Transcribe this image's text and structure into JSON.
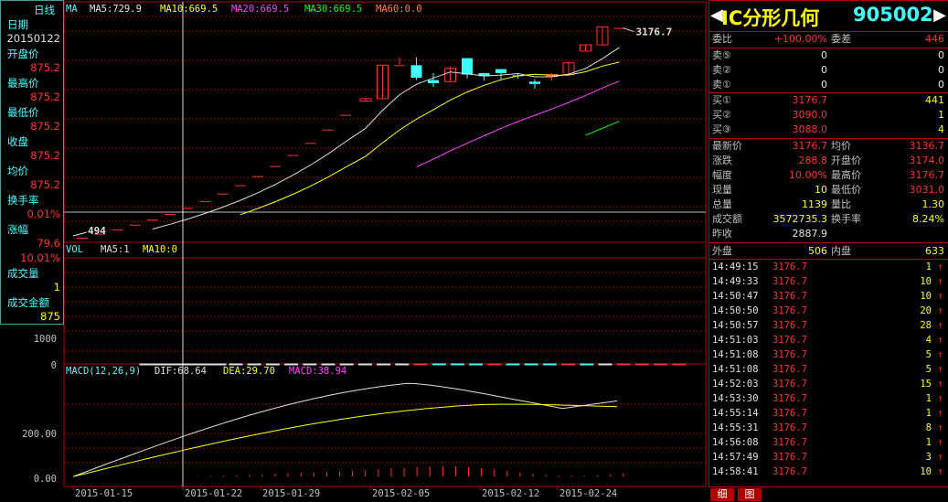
{
  "left_panel": {
    "title": "日线",
    "items": [
      {
        "label": "日期",
        "value": "20150122",
        "value_color": "#e0e0e0"
      },
      {
        "label": "开盘价",
        "value": "875.2"
      },
      {
        "label": "最高价",
        "value": "875.2"
      },
      {
        "label": "最低价",
        "value": "875.2"
      },
      {
        "label": "收盘",
        "value": "875.2"
      },
      {
        "label": "均价",
        "value": "875.2"
      },
      {
        "label": "换手率",
        "value": "0.01%"
      },
      {
        "label": "涨幅",
        "value": "79.6"
      },
      {
        "label": "",
        "value": "10.01%"
      },
      {
        "label": "成交量",
        "value": "1",
        "value_color": "#ffff00"
      },
      {
        "label": "成交金额",
        "value": "875",
        "value_color": "#ffff00"
      }
    ]
  },
  "ma_legend": [
    {
      "text": "MA",
      "color": "#40ffff"
    },
    {
      "text": "MA5:729.9",
      "color": "#e0e0e0"
    },
    {
      "text": "MA10:669.5",
      "color": "#ffff00"
    },
    {
      "text": "MA20:669.5",
      "color": "#ff40ff"
    },
    {
      "text": "MA30:669.5",
      "color": "#00ff00"
    },
    {
      "text": "MA60:0.0",
      "color": "#ff8040"
    }
  ],
  "vol_legend": [
    {
      "text": "VOL",
      "color": "#40ffff"
    },
    {
      "text": "MA5:1",
      "color": "#e0e0e0"
    },
    {
      "text": "MA10:0",
      "color": "#ffff00"
    }
  ],
  "macd_legend": [
    {
      "text": "MACD(12,26,9)",
      "color": "#40ffff"
    },
    {
      "text": "DIF:68.64",
      "color": "#e0e0e0"
    },
    {
      "text": "DEA:29.70",
      "color": "#ffff00"
    },
    {
      "text": "MACD:38.94",
      "color": "#ff40ff"
    }
  ],
  "price_labels": {
    "last_high": "3176.7",
    "low_marker": "494"
  },
  "vol_axis": [
    "1000",
    "0"
  ],
  "macd_axis": [
    "200.00",
    "0.00"
  ],
  "date_axis": [
    "2015-01-15",
    "2015-01-22",
    "2015-01-29",
    "2015-02-05",
    "2015-02-12",
    "2015-02-24"
  ],
  "colors": {
    "up": "#ff3030",
    "down": "#40ffff",
    "grid": "#b00000"
  },
  "chart_data": {
    "type": "candlestick",
    "note_dates": [
      "2015-01-15",
      "2015-01-22",
      "2015-01-29",
      "2015-02-05",
      "2015-02-12",
      "2015-02-24"
    ],
    "candles": [
      {
        "o": 494,
        "h": 494,
        "l": 494,
        "c": 494
      },
      {
        "o": 545,
        "h": 545,
        "l": 545,
        "c": 545
      },
      {
        "o": 600,
        "h": 600,
        "l": 600,
        "c": 600
      },
      {
        "o": 660,
        "h": 660,
        "l": 660,
        "c": 660
      },
      {
        "o": 726,
        "h": 726,
        "l": 726,
        "c": 726
      },
      {
        "o": 798,
        "h": 798,
        "l": 798,
        "c": 798
      },
      {
        "o": 875,
        "h": 875,
        "l": 875,
        "c": 875
      },
      {
        "o": 963,
        "h": 963,
        "l": 963,
        "c": 963
      },
      {
        "o": 1059,
        "h": 1059,
        "l": 1059,
        "c": 1059
      },
      {
        "o": 1165,
        "h": 1165,
        "l": 1165,
        "c": 1165
      },
      {
        "o": 1282,
        "h": 1282,
        "l": 1282,
        "c": 1282
      },
      {
        "o": 1410,
        "h": 1410,
        "l": 1410,
        "c": 1410
      },
      {
        "o": 1551,
        "h": 1551,
        "l": 1551,
        "c": 1551
      },
      {
        "o": 1706,
        "h": 1706,
        "l": 1706,
        "c": 1706
      },
      {
        "o": 1877,
        "h": 1877,
        "l": 1877,
        "c": 1877
      },
      {
        "o": 2065,
        "h": 2065,
        "l": 2065,
        "c": 2065
      },
      {
        "o": 2240,
        "h": 2272,
        "l": 2240,
        "c": 2272
      },
      {
        "o": 2272,
        "h": 2700,
        "l": 2272,
        "c": 2700
      },
      {
        "o": 2700,
        "h": 2800,
        "l": 2700,
        "c": 2700
      },
      {
        "o": 2700,
        "h": 2800,
        "l": 2510,
        "c": 2540
      },
      {
        "o": 2510,
        "h": 2600,
        "l": 2420,
        "c": 2470
      },
      {
        "o": 2490,
        "h": 2680,
        "l": 2490,
        "c": 2660
      },
      {
        "o": 2790,
        "h": 2790,
        "l": 2530,
        "c": 2580
      },
      {
        "o": 2600,
        "h": 2600,
        "l": 2500,
        "c": 2560
      },
      {
        "o": 2650,
        "h": 2650,
        "l": 2500,
        "c": 2600
      },
      {
        "o": 2570,
        "h": 2600,
        "l": 2530,
        "c": 2560
      },
      {
        "o": 2490,
        "h": 2520,
        "l": 2400,
        "c": 2460
      },
      {
        "o": 2560,
        "h": 2600,
        "l": 2500,
        "c": 2580
      },
      {
        "o": 2580,
        "h": 2750,
        "l": 2580,
        "c": 2730
      },
      {
        "o": 2880,
        "h": 2960,
        "l": 2880,
        "c": 2960
      },
      {
        "o": 2960,
        "h": 3190,
        "l": 2960,
        "c": 3190
      },
      {
        "o": 3176.7,
        "h": 3176.7,
        "l": 3176.7,
        "c": 3176.7
      }
    ],
    "volume": [
      0.05,
      0.05,
      0.05,
      0.05,
      0.05,
      0.05,
      0.05,
      0.05,
      0.05,
      0.05,
      0.05,
      0.05,
      0.05,
      0.05,
      0.05,
      0.05,
      0.05,
      0.05,
      0.05,
      1,
      0.2,
      0.25,
      0.25,
      0.3,
      0.3,
      0.25,
      0.2,
      0.3,
      0.35,
      3.25,
      2.7,
      2.05,
      0.8,
      1.6,
      0.8,
      1.35,
      1.05,
      1.05,
      0.4,
      0.35,
      0.85,
      0.85,
      1.1,
      0.9
    ],
    "macd_hist": [
      0,
      0,
      1,
      1,
      2,
      3,
      4,
      6,
      7,
      9,
      11,
      13,
      15,
      17,
      19,
      21,
      23,
      26,
      29,
      32,
      35,
      38,
      40,
      42,
      41,
      38,
      33,
      27,
      22,
      16,
      11,
      7,
      5,
      4,
      3,
      6,
      9,
      13
    ],
    "ylim_price": [
      400,
      3300
    ],
    "ylim_vol": [
      0,
      3800
    ],
    "ylim_macd": [
      -10,
      400
    ]
  },
  "quote": {
    "title": "IC分形几何",
    "code": "905002",
    "weibi": {
      "label": "委比",
      "value": "+100.00%"
    },
    "weicha": {
      "label": "委差",
      "value": "446"
    },
    "sells": [
      {
        "label": "卖⑤",
        "price": "0",
        "vol": "0"
      },
      {
        "label": "卖②",
        "price": "0",
        "vol": "0"
      },
      {
        "label": "卖①",
        "price": "0",
        "vol": "0"
      }
    ],
    "buys": [
      {
        "label": "买①",
        "price": "3176.7",
        "vol": "441"
      },
      {
        "label": "买②",
        "price": "3090.0",
        "vol": "1"
      },
      {
        "label": "买③",
        "price": "3088.0",
        "vol": "4"
      }
    ],
    "stats": [
      {
        "l1": "最新价",
        "v1": "3176.7",
        "c1": "#ff3030",
        "l2": "均价",
        "v2": "3136.7",
        "c2": "#ff3030"
      },
      {
        "l1": "涨跌",
        "v1": "288.8",
        "c1": "#ff3030",
        "l2": "开盘价",
        "v2": "3174.0",
        "c2": "#ff3030"
      },
      {
        "l1": "幅度",
        "v1": "10.00%",
        "c1": "#ff3030",
        "l2": "最高价",
        "v2": "3176.7",
        "c2": "#ff3030"
      },
      {
        "l1": "现量",
        "v1": "10",
        "c1": "#ffff00",
        "l2": "最低价",
        "v2": "3031.0",
        "c2": "#ff3030"
      },
      {
        "l1": "总量",
        "v1": "1139",
        "c1": "#ffff00",
        "l2": "量比",
        "v2": "1.30",
        "c2": "#ffff00"
      },
      {
        "l1": "成交额",
        "v1": "3572735.3",
        "c1": "#ffff00",
        "l2": "换手率",
        "v2": "8.24%",
        "c2": "#ffff00"
      },
      {
        "l1": "昨收",
        "v1": "2887.9",
        "c1": "#e0e0e0",
        "l2": "",
        "v2": "",
        "c2": "#e0e0e0"
      }
    ],
    "waipan": {
      "label": "外盘",
      "value": "506"
    },
    "neipan": {
      "label": "内盘",
      "value": "633"
    },
    "ticks": [
      {
        "time": "14:49:15",
        "price": "3176.7",
        "qty": "1"
      },
      {
        "time": "14:49:33",
        "price": "3176.7",
        "qty": "10"
      },
      {
        "time": "14:50:47",
        "price": "3176.7",
        "qty": "10"
      },
      {
        "time": "14:50:50",
        "price": "3176.7",
        "qty": "20"
      },
      {
        "time": "14:50:57",
        "price": "3176.7",
        "qty": "28"
      },
      {
        "time": "14:51:03",
        "price": "3176.7",
        "qty": "4"
      },
      {
        "time": "14:51:08",
        "price": "3176.7",
        "qty": "5"
      },
      {
        "time": "14:51:08",
        "price": "3176.7",
        "qty": "5"
      },
      {
        "time": "14:52:03",
        "price": "3176.7",
        "qty": "15"
      },
      {
        "time": "14:53:30",
        "price": "3176.7",
        "qty": "1"
      },
      {
        "time": "14:55:14",
        "price": "3176.7",
        "qty": "1"
      },
      {
        "time": "14:55:31",
        "price": "3176.7",
        "qty": "8"
      },
      {
        "time": "14:56:08",
        "price": "3176.7",
        "qty": "1"
      },
      {
        "time": "14:57:49",
        "price": "3176.7",
        "qty": "3"
      },
      {
        "time": "14:58:41",
        "price": "3176.7",
        "qty": "10"
      }
    ],
    "tick_arrow": "↑",
    "tabs": [
      "细",
      "图"
    ]
  }
}
